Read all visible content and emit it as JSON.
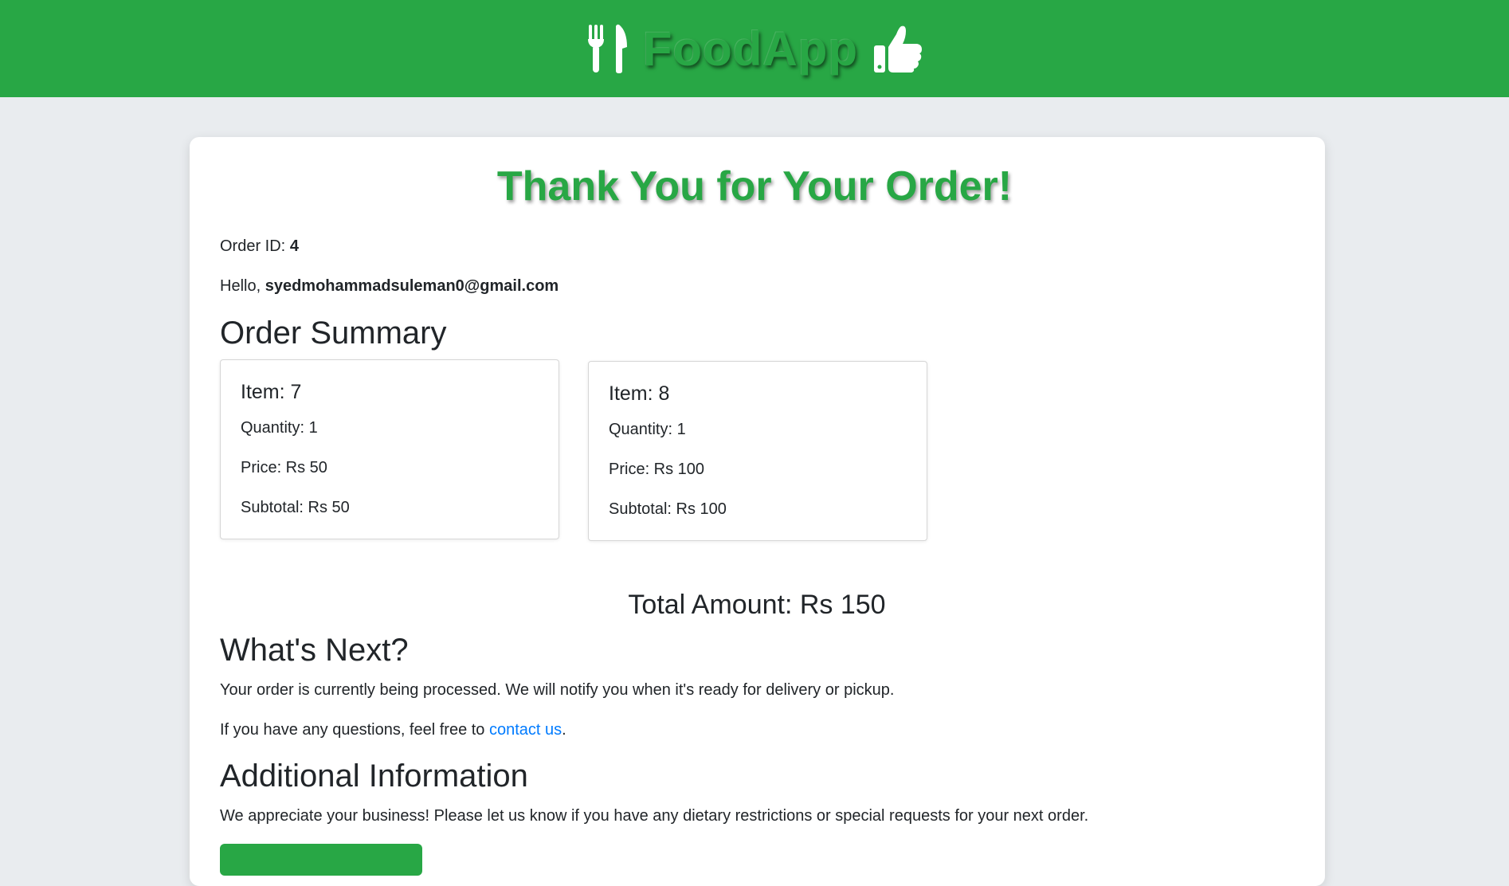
{
  "brand": {
    "name": "FoodApp",
    "left_icon": "fork-knife-icon",
    "right_icon": "thumbs-up-icon"
  },
  "heading": "Thank You for Your Order!",
  "order": {
    "id_label": "Order ID:",
    "id_value": "4",
    "greeting": "Hello,",
    "email": "syedmohammadsuleman0@gmail.com"
  },
  "summary": {
    "title": "Order Summary",
    "items": [
      {
        "title": "Item: 7",
        "quantity": "Quantity: 1",
        "price": "Price: Rs 50",
        "subtotal": "Subtotal: Rs 50"
      },
      {
        "title": "Item: 8",
        "quantity": "Quantity: 1",
        "price": "Price: Rs 100",
        "subtotal": "Subtotal: Rs 100"
      }
    ],
    "total": "Total Amount: Rs 150"
  },
  "next": {
    "title": "What's Next?",
    "processing": "Your order is currently being processed. We will notify you when it's ready for delivery or pickup.",
    "questions_prefix": "If you have any questions, feel free to",
    "contact_link": "contact us",
    "questions_suffix": "."
  },
  "additional": {
    "title": "Additional Information",
    "text": "We appreciate your business! Please let us know if you have any dietary restrictions or special requests for your next order."
  },
  "colors": {
    "primary": "#28a745",
    "link": "#007bff",
    "background": "#e9ecef"
  }
}
